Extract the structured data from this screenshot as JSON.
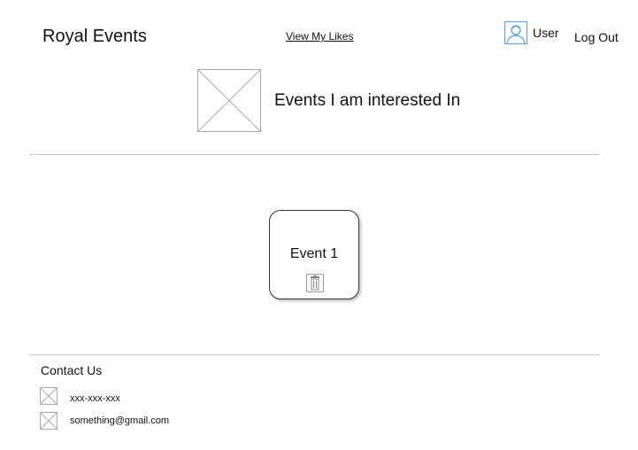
{
  "header": {
    "brand": "Royal Events",
    "likes_link": "View My Likes",
    "user_label": "User",
    "logout_label": "Log Out",
    "avatar_icon": "user-avatar-icon"
  },
  "hero": {
    "image_icon": "image-placeholder-icon",
    "title": "Events I am interested In"
  },
  "events": [
    {
      "title": "Event 1",
      "delete_icon": "trash-icon"
    }
  ],
  "footer": {
    "heading": "Contact Us",
    "phone": "xxx-xxx-xxx",
    "email": "something@gmail.com",
    "phone_icon": "image-placeholder-icon",
    "email_icon": "image-placeholder-icon"
  },
  "colors": {
    "divider": "#c8c8c8",
    "placeholder_stroke": "#aaaaaa",
    "avatar_accent": "#5aa0d8",
    "card_border": "#333333"
  }
}
